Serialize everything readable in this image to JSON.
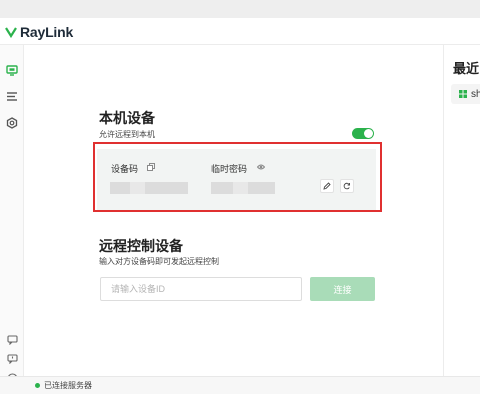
{
  "app": {
    "brand": "RayLink",
    "accent": "#2bb24c",
    "highlight_color": "#e03030"
  },
  "sidebar": {
    "items": [
      {
        "name": "monitor-icon",
        "active": true
      },
      {
        "name": "list-icon",
        "active": false
      },
      {
        "name": "settings-hex-icon",
        "active": false
      }
    ],
    "bottom": [
      "message-icon",
      "feedback-icon",
      "compass-icon"
    ]
  },
  "local_device": {
    "title": "本机设备",
    "allow_remote_label": "允许远程到本机",
    "allow_remote_on": true,
    "device_code_label": "设备码",
    "temp_password_label": "临时密码"
  },
  "remote_control": {
    "title": "远程控制设备",
    "subtitle": "输入对方设备码即可发起远程控制",
    "input_placeholder": "请输入设备ID",
    "connect_label": "连接"
  },
  "recent": {
    "title": "最近",
    "items": [
      {
        "label": "sh",
        "icon": "windows-icon"
      }
    ]
  },
  "status": {
    "text": "已连接服务器",
    "color": "#2bb24c"
  }
}
